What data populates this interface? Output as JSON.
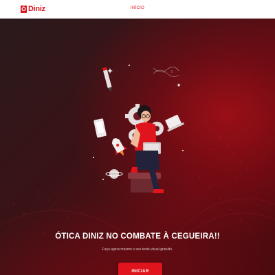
{
  "header": {
    "logo_mark": "Ó",
    "logo_text": "Diniz",
    "nav_link": "INÍCIO"
  },
  "hero": {
    "headline": "ÓTICA DINIZ NO COMBATE À CEGUEIRA!!",
    "subtitle": "Faça agora mesmo o seu teste visual gratuito.",
    "cta_label": "INICIAR"
  },
  "colors": {
    "brand_red": "#d9181f",
    "button_red": "#e0141c",
    "hero_dark": "#2a1a1c"
  },
  "icons": [
    "person-with-laptop-illustration",
    "gear-icon",
    "rocket-icon",
    "planet-icon",
    "pencil-icon",
    "tablet-icon",
    "dna-icon",
    "sparkle-icon"
  ]
}
